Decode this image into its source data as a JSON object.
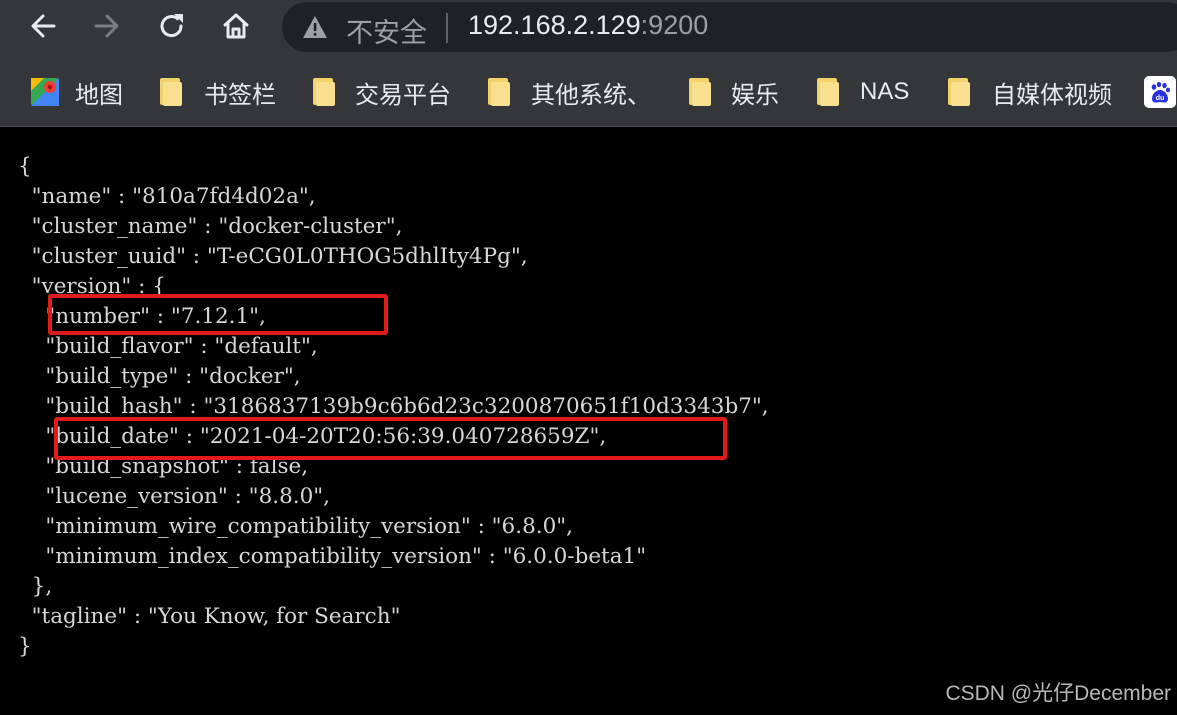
{
  "toolbar": {
    "back_icon": "arrow-left-icon",
    "forward_icon": "arrow-right-icon",
    "reload_icon": "reload-icon",
    "home_icon": "home-icon"
  },
  "omnibox": {
    "security_icon": "warning-triangle-icon",
    "security_label": "不安全",
    "url_host": "192.168.2.129",
    "url_port": ":9200"
  },
  "bookmarks": [
    {
      "label": "地图",
      "icon": "google-maps-icon"
    },
    {
      "label": "书签栏",
      "icon": "folder-icon"
    },
    {
      "label": "交易平台",
      "icon": "folder-icon"
    },
    {
      "label": "其他系统、",
      "icon": "folder-icon"
    },
    {
      "label": "娱乐",
      "icon": "folder-icon"
    },
    {
      "label": "NAS",
      "icon": "folder-icon"
    },
    {
      "label": "自媒体视频",
      "icon": "folder-icon"
    },
    {
      "label": "",
      "icon": "baidu-icon"
    }
  ],
  "json_lines": [
    "{",
    "  \"name\" : \"810a7fd4d02a\",",
    "  \"cluster_name\" : \"docker-cluster\",",
    "  \"cluster_uuid\" : \"T-eCG0L0THOG5dhlIty4Pg\",",
    "  \"version\" : {",
    "    \"number\" : \"7.12.1\",",
    "    \"build_flavor\" : \"default\",",
    "    \"build_type\" : \"docker\",",
    "    \"build_hash\" : \"3186837139b9c6b6d23c3200870651f10d3343b7\",",
    "    \"build_date\" : \"2021-04-20T20:56:39.040728659Z\",",
    "    \"build_snapshot\" : false,",
    "    \"lucene_version\" : \"8.8.0\",",
    "    \"minimum_wire_compatibility_version\" : \"6.8.0\",",
    "    \"minimum_index_compatibility_version\" : \"6.0.0-beta1\"",
    "  },",
    "  \"tagline\" : \"You Know, for Search\"",
    "}"
  ],
  "highlight_color": "#e01b1b",
  "watermark": "CSDN @光仔December"
}
